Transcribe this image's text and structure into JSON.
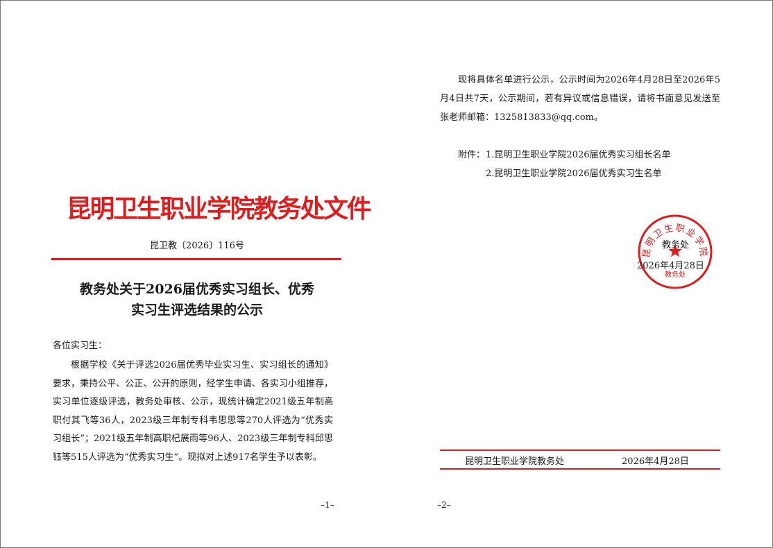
{
  "page1": {
    "header_title": "昆明卫生职业学院教务处文件",
    "doc_number": "昆卫教〔2026〕116号",
    "title_line1": "教务处关于2026届优秀实习组长、优秀",
    "title_line2": "实习生评选结果的公示",
    "salutation": "各位实习生：",
    "body": "根据学校《关于评选2026届优秀毕业实习生、实习组长的通知》要求，秉持公平、公正、公开的原则，经学生申请、各实习小组推荐，实习单位逐级评选，教务处审核、公示，现统计确定2021级五年制高职付其飞等36人，2023级三年制专科韦思思等270人评选为“优秀实习组长”；2021级五年制高职杞展雨等96人、2023级三年制专科邱思钰等515人评选为“优秀实习生”。现拟对上述917名学生予以表彰。",
    "page_number": "–1–"
  },
  "page2": {
    "body": "现将具体名单进行公示，公示时间为2026年4月28日至2026年5月4日共7天，公示期间，若有异议或信息错误，请将书面意见发送至张老师邮箱：1325813833@qq.com。",
    "attachment_label": "附件：",
    "attachment_1": "1.昆明卫生职业学院2026届优秀实习组长名单",
    "attachment_2": "2.昆明卫生职业学院2026届优秀实习生名单",
    "signature_name": "教务处",
    "signature_date": "2026年4月28日",
    "seal_text": "昆明卫生职业学院",
    "seal_bottom": "教务处",
    "footer_org": "昆明卫生职业学院教务处",
    "footer_date": "2026年4月28日",
    "page_number": "–2–"
  },
  "colors": {
    "accent_red": "#e11b1b",
    "text": "#1a1a1a"
  }
}
